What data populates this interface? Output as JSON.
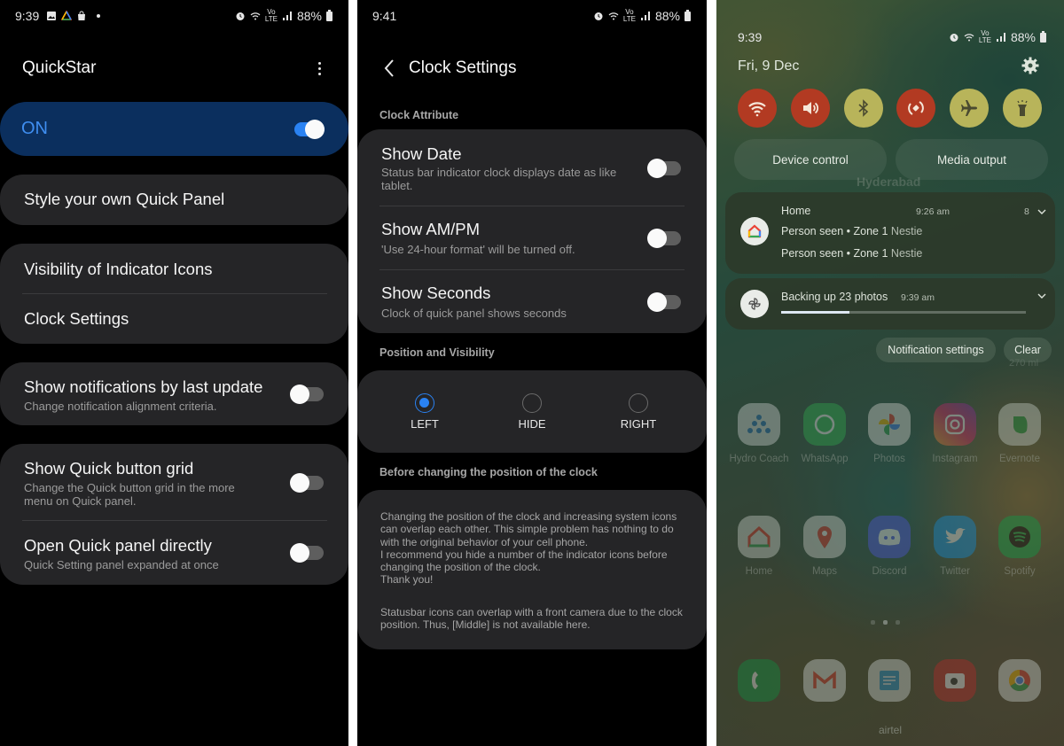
{
  "screens": {
    "quickstar": {
      "status": {
        "time": "9:39",
        "battery": "88%"
      },
      "title": "QuickStar",
      "master": {
        "label": "ON",
        "enabled": true
      },
      "style_item": "Style your own Quick Panel",
      "group1": [
        "Visibility of Indicator Icons",
        "Clock Settings"
      ],
      "notif_by_update": {
        "title": "Show notifications by last update",
        "subtitle": "Change notification alignment criteria.",
        "enabled": false
      },
      "quick_grid": {
        "title": "Show Quick button grid",
        "subtitle": "Change the Quick button grid in the more menu on Quick panel.",
        "enabled": false
      },
      "open_directly": {
        "title": "Open Quick panel directly",
        "subtitle": "Quick Setting panel expanded at once",
        "enabled": false
      }
    },
    "clock_settings": {
      "status": {
        "time": "9:41",
        "battery": "88%"
      },
      "title": "Clock Settings",
      "section_attr": "Clock Attribute",
      "show_date": {
        "title": "Show Date",
        "subtitle": "Status bar indicator clock displays date as like tablet.",
        "enabled": false
      },
      "show_ampm": {
        "title": "Show AM/PM",
        "subtitle": "'Use 24-hour format' will be turned off.",
        "enabled": false
      },
      "show_seconds": {
        "title": "Show Seconds",
        "subtitle": "Clock of quick panel shows seconds",
        "enabled": false
      },
      "section_position": "Position and Visibility",
      "positions": [
        {
          "label": "LEFT",
          "selected": true
        },
        {
          "label": "HIDE",
          "selected": false
        },
        {
          "label": "RIGHT",
          "selected": false
        }
      ],
      "section_note": "Before changing the position of the clock",
      "note_p1": "Changing the position of the clock and increasing system icons can overlap each other. This simple problem has nothing to do with the original behavior of your cell phone.\n I recommend you hide a number of the indicator icons before changing the position of the clock.\n Thank you!",
      "note_p2": "Statusbar icons can overlap with a front camera due to the clock position. Thus, [Middle] is not available here."
    },
    "quick_panel": {
      "status": {
        "time": "9:39",
        "battery": "88%"
      },
      "date": "Fri, 9 Dec",
      "tiles": [
        {
          "icon": "wifi-icon",
          "state": "on"
        },
        {
          "icon": "sound-icon",
          "state": "on"
        },
        {
          "icon": "bluetooth-icon",
          "state": "off"
        },
        {
          "icon": "auto-rotate-icon",
          "state": "on"
        },
        {
          "icon": "airplane-icon",
          "state": "off"
        },
        {
          "icon": "flashlight-icon",
          "state": "off"
        }
      ],
      "device_control": "Device control",
      "media_output": "Media output",
      "behind_text": "Hyderabad",
      "notif_home": {
        "app": "Home",
        "time": "9:26 am",
        "count": "8",
        "lines": [
          {
            "title": "Person seen • Zone 1",
            "sub": "Nestie"
          },
          {
            "title": "Person seen • Zone 1",
            "sub": "Nestie"
          }
        ]
      },
      "notif_backup": {
        "title": "Backing up 23 photos",
        "time": "9:39 am",
        "progress": 0.28
      },
      "notification_settings": "Notification settings",
      "clear": "Clear",
      "behind_widget": "270 ml",
      "apps_row1": [
        "Hydro Coach",
        "WhatsApp",
        "Photos",
        "Instagram",
        "Evernote"
      ],
      "apps_row2": [
        "Home",
        "Maps",
        "Discord",
        "Twitter",
        "Spotify"
      ],
      "dock": [
        "Phone",
        "Gmail",
        "Notes",
        "Camera",
        "Chrome"
      ],
      "carrier": "airtel"
    }
  },
  "colors": {
    "accent": "#2a82f2",
    "on_card": "#0b2f5e",
    "card": "#252527",
    "tile_on": "#b23a22",
    "tile_off": "#b8b45a"
  }
}
